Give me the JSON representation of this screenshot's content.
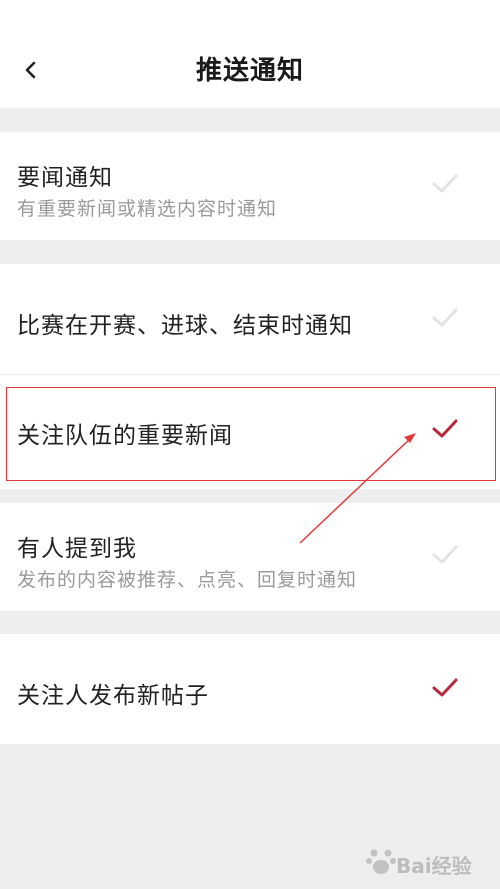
{
  "header": {
    "title": "推送通知",
    "back_icon": "chevron-left-icon"
  },
  "settings": {
    "important_news": {
      "title": "要闻通知",
      "subtitle": "有重要新闻或精选内容时通知",
      "checked": false
    },
    "match_events": {
      "title": "比赛在开赛、进球、结束时通知",
      "checked": false
    },
    "team_news": {
      "title": "关注队伍的重要新闻",
      "checked": true
    },
    "mentions": {
      "title": "有人提到我",
      "subtitle": "发布的内容被推荐、点亮、回复时通知",
      "checked": false
    },
    "followed_posts": {
      "title": "关注人发布新帖子",
      "checked": true
    }
  },
  "colors": {
    "checked": "#b8283a",
    "unchecked": "#e4e4e4",
    "annotation": "#e23b3b",
    "background": "#eeeef0"
  },
  "watermark": {
    "text": "Bai经验",
    "icon": "paw-logo-icon"
  }
}
